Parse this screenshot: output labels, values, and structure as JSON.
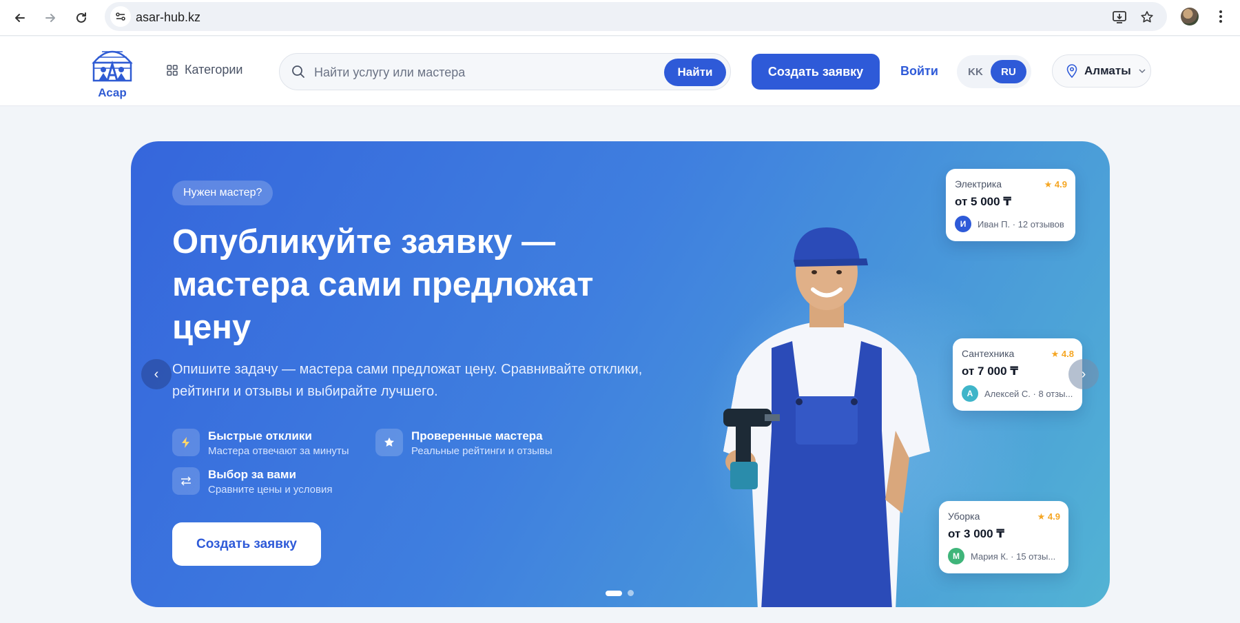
{
  "browser": {
    "url": "asar-hub.kz"
  },
  "header": {
    "logo_text": "Асар",
    "categories_label": "Категории",
    "search_placeholder": "Найти услугу или мастера",
    "search_button": "Найти",
    "create_button": "Создать заявку",
    "login": "Войти",
    "languages": [
      "KK",
      "RU"
    ],
    "active_language": "RU",
    "city": "Алматы"
  },
  "hero": {
    "pill": "Нужен мастер?",
    "headline": "Опубликуйте заявку — мастера сами предложат цену",
    "subtitle": "Опишите задачу — мастера сами предложат цену. Сравнивайте отклики, рейтинги и отзывы и выбирайте лучшего.",
    "features": [
      {
        "title": "Быстрые отклики",
        "subtitle": "Мастера отвечают за минуты",
        "icon": "lightning-icon"
      },
      {
        "title": "Проверенные мастера",
        "subtitle": "Реальные рейтинги и отзывы",
        "icon": "star-icon"
      },
      {
        "title": "Выбор за вами",
        "subtitle": "Сравните цены и условия",
        "icon": "swap-icon"
      }
    ],
    "cta": "Создать заявку",
    "slides_total": 2,
    "slide_active": 1,
    "cards": [
      {
        "category": "Электрика",
        "rating": "4.9",
        "price": "от 5 000 ₸",
        "initial": "И",
        "author": "Иван П. · 12 отзывов",
        "color": "#2e5ad8"
      },
      {
        "category": "Сантехника",
        "rating": "4.8",
        "price": "от 7 000 ₸",
        "initial": "А",
        "author": "Алексей С. · 8 отзы...",
        "color": "#3fb5c9"
      },
      {
        "category": "Уборка",
        "rating": "4.9",
        "price": "от 3 000 ₸",
        "initial": "М",
        "author": "Мария К. · 15 отзы...",
        "color": "#3fb57a"
      }
    ]
  },
  "colors": {
    "primary": "#2e5ad8",
    "rating_star": "#f5a623"
  }
}
